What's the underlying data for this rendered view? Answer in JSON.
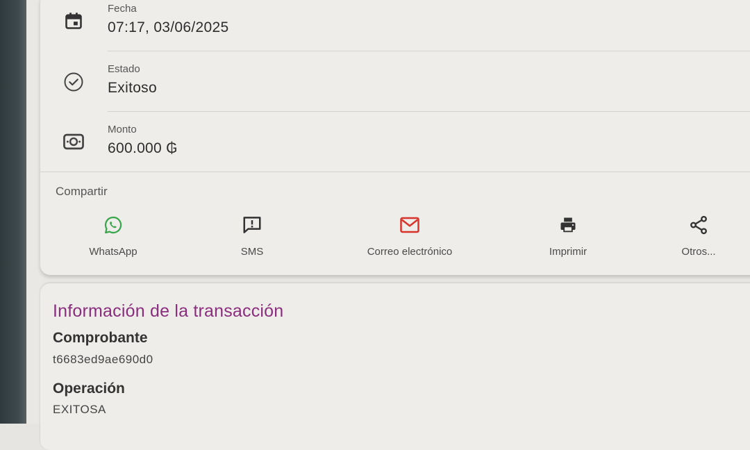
{
  "details": {
    "fecha": {
      "label": "Fecha",
      "value": "07:17, 03/06/2025",
      "icon": "calendar-icon"
    },
    "estado": {
      "label": "Estado",
      "value": "Exitoso",
      "icon": "check-circle-icon"
    },
    "monto": {
      "label": "Monto",
      "value": "600.000 ₲",
      "icon": "cash-icon"
    }
  },
  "share": {
    "title": "Compartir",
    "items": [
      {
        "label": "WhatsApp",
        "icon": "whatsapp-icon",
        "color": "#3aa64c"
      },
      {
        "label": "SMS",
        "icon": "sms-icon",
        "color": "#333333"
      },
      {
        "label": "Correo electrónico",
        "icon": "mail-icon",
        "color": "#d9342b"
      },
      {
        "label": "Imprimir",
        "icon": "printer-icon",
        "color": "#333333"
      },
      {
        "label": "Otros...",
        "icon": "share-icon",
        "color": "#333333"
      }
    ]
  },
  "transaction": {
    "title": "Información de la transacción",
    "comprobante": {
      "label": "Comprobante",
      "value": "t6683ed9ae690d0"
    },
    "operacion": {
      "label": "Operación",
      "value": "EXITOSA"
    }
  },
  "colors": {
    "accent": "#8a2e7d",
    "background": "#e9e8e4",
    "card": "#eeedea"
  }
}
